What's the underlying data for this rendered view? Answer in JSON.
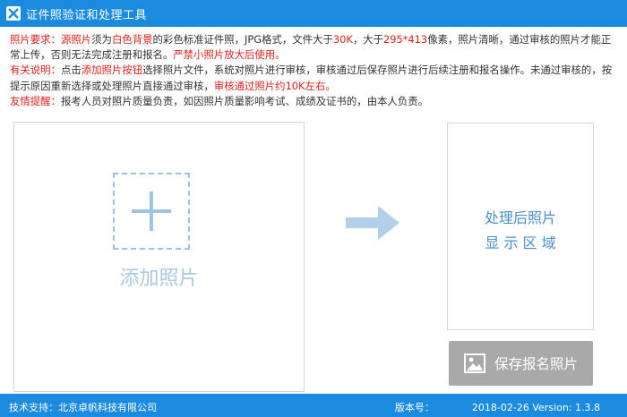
{
  "window": {
    "title": "证件照验证和处理工具"
  },
  "notice": {
    "requirement": {
      "label": "照片要求：",
      "p1": "源照片",
      "p2": "须为",
      "p3": "白色背景",
      "p4": "的彩色标准证件照，JPG格式，文件大于",
      "p5": "30K",
      "p6": "，大于",
      "p7": "295*413",
      "p8": "像素，照片清晰，通过审核的照片才能正常上传，否则无法完成注册和报名。",
      "p9": "严禁小照片放大后使用。"
    },
    "explain": {
      "label": "有关说明：",
      "p1": "点击",
      "p2": "添加照片按钮",
      "p3": "选择照片文件，系统对照片进行审核，审核通过后保存照片进行后续注册和报名操作。未通过审核的，按提示原因重新选择或处理照片直接通过审核，",
      "p4": "审核通过照片约10K左右。"
    },
    "reminder": {
      "label": "友情提醒：",
      "p1": "报考人员对照片质量负责，如因照片质量影响考试、成绩及证书的，由本人负责。"
    }
  },
  "upload": {
    "label": "添加照片"
  },
  "result": {
    "line1": "处理后照片",
    "line2": "显 示 区 域"
  },
  "save_button": {
    "label": "保存报名照片"
  },
  "status": {
    "support": "技术支持：北京卓帆科技有限公司",
    "version_label": "版本号：",
    "version_value": "2018-02-26 Version: 1.3.8"
  },
  "colors": {
    "titlebar": "#1b8be0",
    "accent_red": "#d9231f",
    "upload_dash": "#9fc3e3",
    "result_text": "#4a8fc7",
    "button_gray": "#a9a9a9"
  }
}
